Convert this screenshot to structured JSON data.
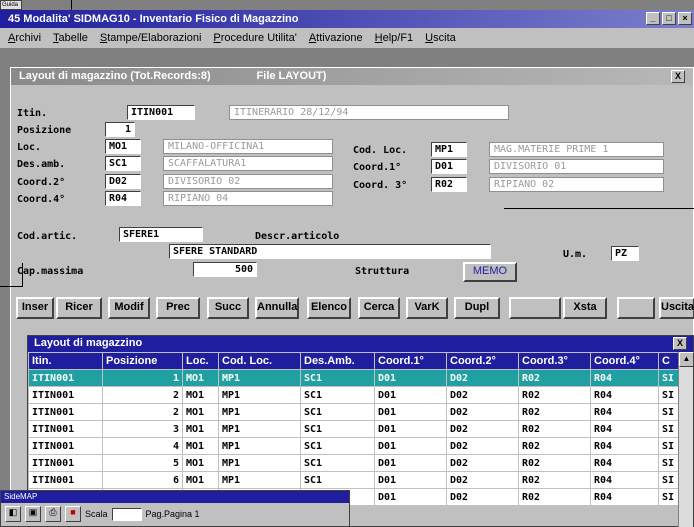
{
  "app": {
    "corner_icon": "Guida",
    "title": "45 Modalita' SIDMAG10 - Inventario Fisico di Magazzino",
    "menu": [
      "Archivi",
      "Tabelle",
      "Stampe/Elaborazioni",
      "Procedure Utilita'",
      "Attivazione",
      "Help/F1",
      "Uscita"
    ]
  },
  "form": {
    "title": "Layout di magazzino (Tot.Records:8)",
    "file": "File LAYOUT)",
    "close": "X",
    "labels": {
      "itin": "Itin.",
      "posizione": "Posizione",
      "loc": "Loc.",
      "desamb": "Des.amb.",
      "coord1": "Coord.1°",
      "coord2": "Coord.2°",
      "coord4": "Coord.4°",
      "codloc": "Cod. Loc.",
      "coord3": "Coord. 3°",
      "codartic": "Cod.artic.",
      "descrart": "Descr.articolo",
      "um": "U.m.",
      "capmax": "Cap.massima",
      "struttura": "Struttura"
    },
    "values": {
      "itin": "ITIN001",
      "itin_desc": "ITINERARIO 28/12/94",
      "posizione": "1",
      "loc": "MO1",
      "loc_desc": "MILANO-OFFICINA1",
      "desamb": "SC1",
      "desamb_desc": "SCAFFALATURA1",
      "coord2": "D02",
      "coord2_desc": "DIVISORIO 02",
      "coord4": "R04",
      "coord4_desc": "RIPIANO 04",
      "codloc": "MP1",
      "codloc_desc": "MAG.MATERIE PRIME 1",
      "coord1": "D01",
      "coord1_desc": "DIVISORIO 01",
      "coord3": "R02",
      "coord3_desc": "RIPIANO 02",
      "codartic": "SFERE1",
      "descrart": "SFERE STANDARD",
      "um": "PZ",
      "capmax": "500"
    },
    "memo_label": "MEMO",
    "buttons": [
      "Inser",
      "Ricer",
      "Modif",
      "Prec",
      "Succ",
      "Annulla",
      "Elenco",
      "Cerca",
      "VarK",
      "Dupl",
      "",
      "Xsta",
      "",
      "Uscita"
    ]
  },
  "grid": {
    "title": "Layout di magazzino",
    "close": "X",
    "columns": [
      "Itin.",
      "Posizione",
      "Loc.",
      "Cod. Loc.",
      "Des.Amb.",
      "Coord.1°",
      "Coord.2°",
      "Coord.3°",
      "Coord.4°",
      "C"
    ],
    "rows": [
      [
        "ITIN001",
        "1",
        "MO1",
        "MP1",
        "SC1",
        "D01",
        "D02",
        "R02",
        "R04",
        "SI"
      ],
      [
        "ITIN001",
        "2",
        "MO1",
        "MP1",
        "SC1",
        "D01",
        "D02",
        "R02",
        "R04",
        "SI"
      ],
      [
        "ITIN001",
        "2",
        "MO1",
        "MP1",
        "SC1",
        "D01",
        "D02",
        "R02",
        "R04",
        "SI"
      ],
      [
        "ITIN001",
        "3",
        "MO1",
        "MP1",
        "SC1",
        "D01",
        "D02",
        "R02",
        "R04",
        "SI"
      ],
      [
        "ITIN001",
        "4",
        "MO1",
        "MP1",
        "SC1",
        "D01",
        "D02",
        "R02",
        "R04",
        "SI"
      ],
      [
        "ITIN001",
        "5",
        "MO1",
        "MP1",
        "SC1",
        "D01",
        "D02",
        "R02",
        "R04",
        "SI"
      ],
      [
        "ITIN001",
        "6",
        "MO1",
        "MP1",
        "SC1",
        "D01",
        "D02",
        "R02",
        "R04",
        "SI"
      ],
      [
        "",
        "",
        "",
        "",
        "",
        "D01",
        "D02",
        "R02",
        "R04",
        "SI"
      ]
    ],
    "selected_row": 0
  },
  "taskwin": {
    "title": "SideMAP",
    "zoom_label": "Scala",
    "page_label": "Pag.Pagina 1"
  },
  "colors": {
    "title_blue": "#1e1e9e",
    "selected_row": "#20a0a0",
    "face": "#c0c0c0"
  }
}
